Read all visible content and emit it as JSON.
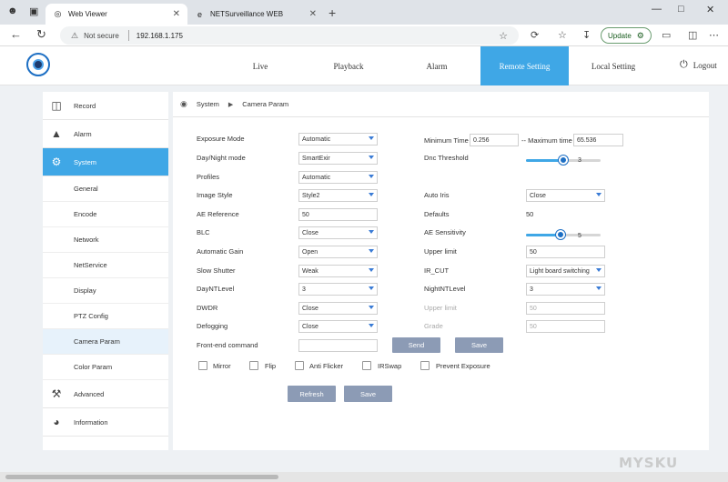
{
  "browser": {
    "tabs": [
      {
        "title": "Web Viewer",
        "icon": "globe-icon",
        "active": true
      },
      {
        "title": "NETSurveillance WEB",
        "icon": "edge-icon",
        "active": false
      }
    ],
    "address": {
      "security_label": "Not secure",
      "url": "192.168.1.175"
    },
    "update_label": "Update"
  },
  "app": {
    "nav": [
      {
        "label": "Live"
      },
      {
        "label": "Playback"
      },
      {
        "label": "Alarm"
      },
      {
        "label": "Remote Setting",
        "active": true
      },
      {
        "label": "Local Setting"
      }
    ],
    "logout_label": "Logout"
  },
  "sidebar": {
    "sections": [
      {
        "label": "Record",
        "icon": "camera-icon"
      },
      {
        "label": "Alarm",
        "icon": "siren-icon"
      },
      {
        "label": "System",
        "icon": "gear-icon",
        "active": true
      },
      {
        "label": "Advanced",
        "icon": "wrench-icon"
      },
      {
        "label": "Information",
        "icon": "chart-icon"
      }
    ],
    "system_items": [
      {
        "label": "General"
      },
      {
        "label": "Encode"
      },
      {
        "label": "Network"
      },
      {
        "label": "NetService"
      },
      {
        "label": "Display"
      },
      {
        "label": "PTZ Config"
      },
      {
        "label": "Camera Param",
        "active": true
      },
      {
        "label": "Color Param"
      }
    ]
  },
  "breadcrumb": {
    "root": "System",
    "current": "Camera Param"
  },
  "form": {
    "left": [
      {
        "label": "Exposure Mode",
        "type": "select",
        "value": "Automatic"
      },
      {
        "label": "Day/Night mode",
        "type": "select",
        "value": "SmartExir"
      },
      {
        "label": "Profiles",
        "type": "select",
        "value": "Automatic"
      },
      {
        "label": "Image Style",
        "type": "select",
        "value": "Style2"
      },
      {
        "label": "AE Reference",
        "type": "input",
        "value": "50"
      },
      {
        "label": "BLC",
        "type": "select",
        "value": "Close"
      },
      {
        "label": "Automatic Gain",
        "type": "select",
        "value": "Open"
      },
      {
        "label": "Slow Shutter",
        "type": "select",
        "value": "Weak"
      },
      {
        "label": "DayNTLevel",
        "type": "select",
        "value": "3"
      },
      {
        "label": "DWDR",
        "type": "select",
        "value": "Close"
      },
      {
        "label": "Defogging",
        "type": "select",
        "value": "Close"
      }
    ],
    "exposure_time": {
      "min_label": "Minimum Time",
      "min_value": "0.256",
      "max_label": "-- Maximum time",
      "max_value": "65.536"
    },
    "right": {
      "dnc_threshold": {
        "label": "Dnc Threshold",
        "value": "3",
        "fraction": 0.5
      },
      "auto_iris": {
        "label": "Auto Iris",
        "value": "Close"
      },
      "defaults": {
        "label": "Defaults",
        "value": "50"
      },
      "ae_sensitivity": {
        "label": "AE Sensitivity",
        "value": "5",
        "fraction": 0.46
      },
      "upper_limit": {
        "label": "Upper limit",
        "value": "50"
      },
      "ir_cut": {
        "label": "IR_CUT",
        "value": "Light board switching"
      },
      "night_nt_level": {
        "label": "NightNTLevel",
        "value": "3"
      },
      "upper_limit_2": {
        "label": "Upper limit",
        "value": "50"
      },
      "grade": {
        "label": "Grade",
        "value": "50"
      }
    },
    "front_end": {
      "label": "Front-end command",
      "value": "",
      "send_label": "Send",
      "save_label": "Save"
    },
    "checkboxes": [
      {
        "label": "Mirror",
        "checked": false
      },
      {
        "label": "Flip",
        "checked": false
      },
      {
        "label": "Anti Flicker",
        "checked": false
      },
      {
        "label": "IRSwap",
        "checked": false
      },
      {
        "label": "Prevent Exposure",
        "checked": false
      }
    ],
    "buttons": {
      "refresh_label": "Refresh",
      "save_label": "Save"
    }
  },
  "colors": {
    "accent": "#3fa7e6",
    "button": "#8c9bb5",
    "slider_thumb": "#1d6fc4"
  }
}
